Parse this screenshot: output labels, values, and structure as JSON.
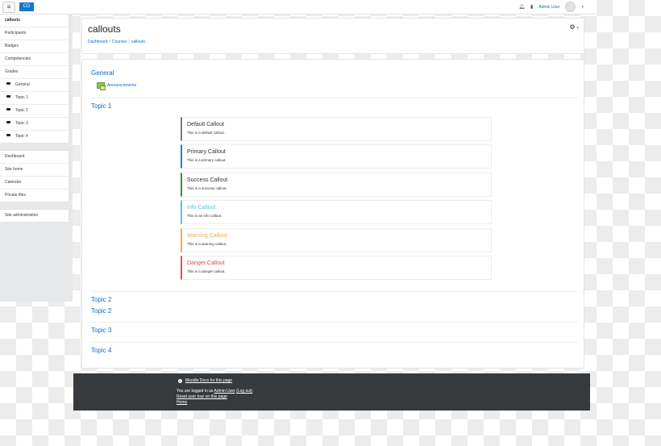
{
  "navbar": {
    "toggle_icon": "≡",
    "brand": "CD",
    "user_name": "Admin User",
    "bell_icon": "bell-icon",
    "chat_icon": "chat-icon"
  },
  "sidebar": {
    "course_items": [
      {
        "label": "callouts",
        "active": true
      },
      {
        "label": "Participants"
      },
      {
        "label": "Badges"
      },
      {
        "label": "Competencies"
      },
      {
        "label": "Grades"
      },
      {
        "label": "General",
        "folder": true
      },
      {
        "label": "Topic 1",
        "folder": true
      },
      {
        "label": "Topic 2",
        "folder": true
      },
      {
        "label": "Topic 3",
        "folder": true
      },
      {
        "label": "Topic 4",
        "folder": true
      }
    ],
    "site_items": [
      "Dashboard",
      "Site home",
      "Calendar",
      "Private files"
    ],
    "admin_items": [
      "Site administration"
    ]
  },
  "header": {
    "title": "callouts",
    "breadcrumb": [
      "Dashboard",
      "Courses",
      "callouts"
    ],
    "breadcrumb_sep": "/"
  },
  "main": {
    "sections": {
      "general": "General",
      "announcements": "Announcements",
      "topic1": "Topic 1",
      "topic2": "Topic 2",
      "topic2b": "Topic 2",
      "topic3": "Topic 3",
      "topic4": "Topic 4"
    },
    "callouts": [
      {
        "key": "default",
        "title": "Default Callout",
        "text": "This is a default callout.",
        "color": "#777777"
      },
      {
        "key": "primary",
        "title": "Primary Callout",
        "text": "This is a primary callout.",
        "color": "#2a7ebf"
      },
      {
        "key": "success",
        "title": "Success Callout",
        "text": "This is a success callout.",
        "color": "#3c8c3c"
      },
      {
        "key": "info",
        "title": "Info Callout",
        "text": "This is an info callout.",
        "color": "#5bc0de"
      },
      {
        "key": "warning",
        "title": "Warning Callout",
        "text": "This is a warning callout.",
        "color": "#f0ad4e"
      },
      {
        "key": "danger",
        "title": "Danger Callout",
        "text": "This is a danger callout.",
        "color": "#d9534f"
      }
    ]
  },
  "footer": {
    "docs_link": "Moodle Docs for this page",
    "logged_prefix": "You are logged in as",
    "logged_user": "Admin User",
    "logout": "(Log out)",
    "reset_tour": "Reset user tour on this page",
    "home": "Home"
  },
  "colors": {
    "link": "#0f6cbf",
    "brand": "#1177d1",
    "footer_bg": "#373a3c"
  }
}
